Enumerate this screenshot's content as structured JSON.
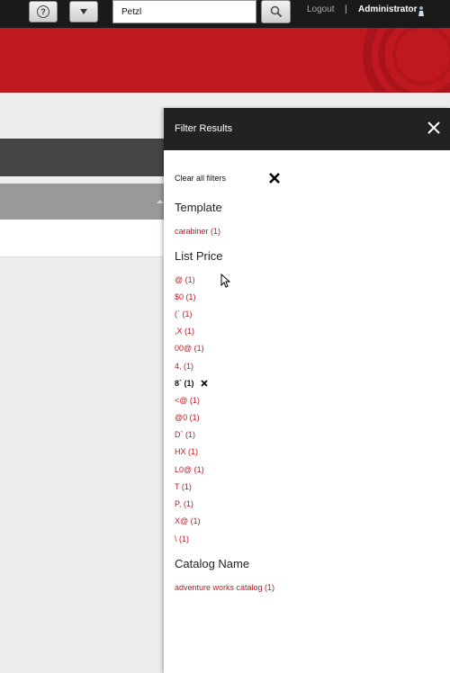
{
  "topbar": {
    "help_icon_glyph": "?",
    "search_value": "Petzl",
    "logout_label": "Logout",
    "separator": "|",
    "user_label": "Administrator"
  },
  "panel": {
    "title": "Filter Results",
    "clear_all_label": "Clear all filters",
    "sections": [
      {
        "heading": "Template",
        "items": [
          {
            "label": "carabiner (1)"
          }
        ]
      },
      {
        "heading": "List Price",
        "items": [
          {
            "label": "@ (1)"
          },
          {
            "label": "$0 (1)"
          },
          {
            "label": "(` (1)"
          },
          {
            "label": ",X (1)"
          },
          {
            "label": "00@ (1)"
          },
          {
            "label": "4, (1)"
          },
          {
            "label": "8` (1)",
            "selected": true
          },
          {
            "label": "<@ (1)"
          },
          {
            "label": "@0 (1)"
          },
          {
            "label": "D` (1)"
          },
          {
            "label": "HX (1)"
          },
          {
            "label": "L0@ (1)"
          },
          {
            "label": "T (1)"
          },
          {
            "label": "P, (1)"
          },
          {
            "label": "X@ (1)"
          },
          {
            "label": "\\ (1)"
          }
        ]
      },
      {
        "heading": "Catalog Name",
        "items": [
          {
            "label": "adventure works catalog (1)"
          }
        ]
      }
    ]
  },
  "colors": {
    "accent": "#c0181f",
    "panel_header": "#222222",
    "topbar": "#1a1a1a"
  }
}
